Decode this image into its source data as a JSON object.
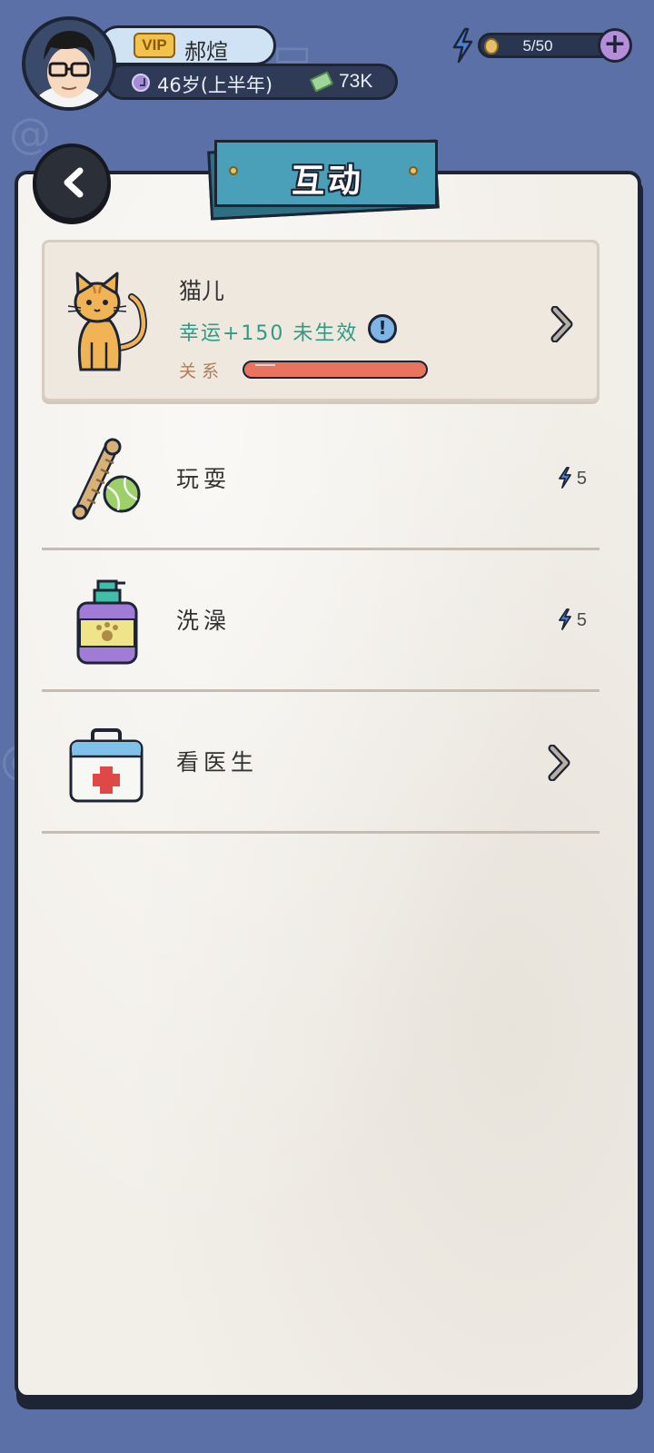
{
  "player": {
    "vip_label": "VIP",
    "name": "郝煊",
    "age": "46岁(上半年)",
    "money": "73K"
  },
  "energy": {
    "value": "5/50",
    "add_label": "+"
  },
  "page": {
    "title": "互动"
  },
  "pet": {
    "name": "猫儿",
    "effect": "幸运+150 未生效",
    "info_label": "!",
    "relation_label": "关系"
  },
  "actions": [
    {
      "label": "玩耍",
      "cost": "5",
      "icon": "toy-rope-ball-icon"
    },
    {
      "label": "洗澡",
      "cost": "5",
      "icon": "shampoo-bottle-icon"
    },
    {
      "label": "看医生",
      "cost": "",
      "icon": "first-aid-kit-icon"
    }
  ],
  "colors": {
    "background": "#5a70a6",
    "paper": "#f2efe9",
    "banner": "#4aa0b8",
    "effect_text": "#2f9a86",
    "relation_bar": "#e8735e",
    "energy_icon": "#4a7fd6"
  }
}
